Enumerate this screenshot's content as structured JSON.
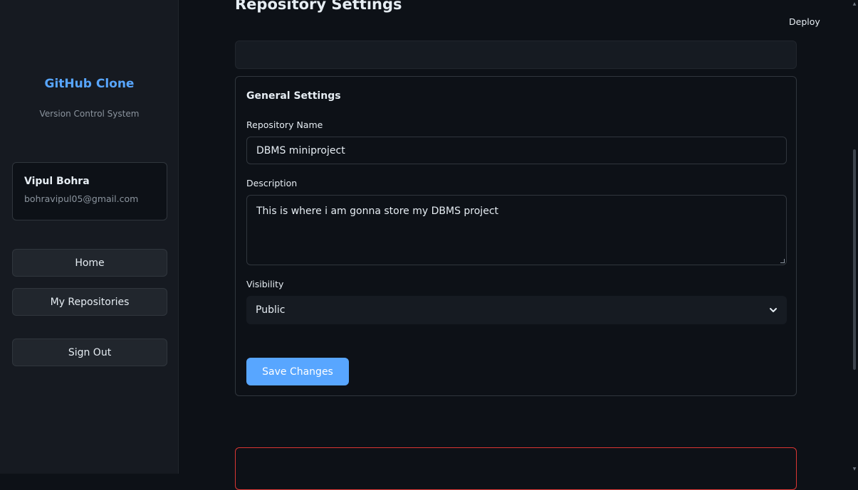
{
  "sidebar": {
    "brand_title": "GitHub Clone",
    "brand_subtitle": "Version Control System",
    "user": {
      "name": "Vipul Bohra",
      "email": "bohravipul05@gmail.com"
    },
    "nav": {
      "home": "Home",
      "repositories": "My Repositories",
      "sign_out": "Sign Out"
    }
  },
  "header": {
    "title": "Repository Settings",
    "deploy_label": "Deploy"
  },
  "general": {
    "section_title": "General Settings",
    "name_label": "Repository Name",
    "name_value": "DBMS miniproject",
    "description_label": "Description",
    "description_value": "This is where i am gonna store my DBMS project",
    "visibility_label": "Visibility",
    "visibility_value": "Public",
    "save_label": "Save Changes"
  },
  "colors": {
    "accent": "#58a6ff",
    "danger_border": "#da3633",
    "background": "#0d1117",
    "sidebar": "#161a21"
  },
  "icons": {
    "select": "chevron-down-icon",
    "scroll_up": "scroll-up-arrow-icon",
    "scroll_down": "scroll-down-arrow-icon"
  }
}
